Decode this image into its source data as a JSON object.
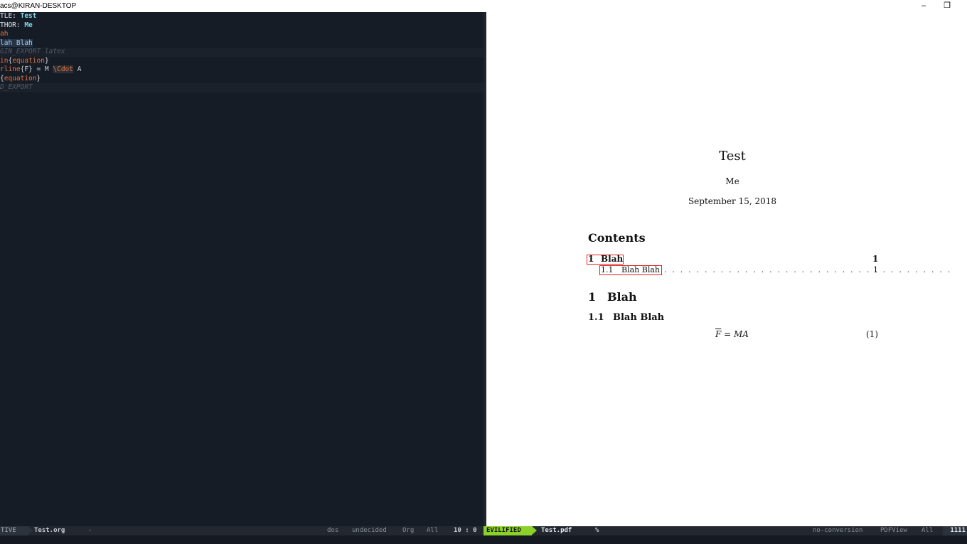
{
  "window": {
    "title": "acs@KIRAN-DESKTOP",
    "minimize_symbol": "–",
    "restore_symbol": "❐"
  },
  "editor": {
    "lines": [
      {
        "kw": "TLE: ",
        "val": "Test"
      },
      {
        "kw": "THOR: ",
        "val": "Me"
      },
      {
        "heading": "ah"
      },
      {
        "heading2": "lah Blah"
      },
      {
        "meta": "GIN_EXPORT latex"
      },
      {
        "a": "in",
        "b": "{",
        "c": "equation",
        "d": "}"
      },
      {
        "a": "rline",
        "b": "{F} = M ",
        "c": "\\Cdot",
        "d": " A"
      },
      {
        "a": "",
        "b": "{",
        "c": "equation",
        "d": "}"
      },
      {
        "meta": "D_EXPORT"
      }
    ]
  },
  "pdf": {
    "title": "Test",
    "author": "Me",
    "date": "September 15, 2018",
    "contents_heading": "Contents",
    "toc": [
      {
        "num": "1",
        "label": "Blah",
        "page": "1"
      },
      {
        "num": "1.1",
        "label": "Blah Blah",
        "dots": ". . . . . . . . . . . . . . . . . . . . . . . . . . . . . . . . . . . .",
        "page": "1"
      }
    ],
    "section1": {
      "num": "1",
      "title": "Blah"
    },
    "section11": {
      "num": "1.1",
      "title": "Blah Blah"
    },
    "equation": {
      "lhs": "F",
      "eq": " = ",
      "rhs": "MA",
      "number": "(1)"
    }
  },
  "modeline_left": {
    "state": "TIVE",
    "buffer": "Test.org",
    "modified": "-",
    "eol": "dos",
    "coding": "undecided",
    "major_mode": "Org",
    "position": "All",
    "line_col": "10 : 0"
  },
  "modeline_right": {
    "state": "EVILIFIED",
    "buffer": "Test.pdf",
    "percent": "%",
    "encoding": "no-conversion",
    "major_mode": "PDFView",
    "position": "All",
    "page": "1111"
  },
  "colors": {
    "editor_bg": "#161c26",
    "evilified_green": "#8bd12a",
    "link_box_red": "#e02020",
    "org_orange": "#e4733f",
    "keyword_cyan": "#7fd9e8"
  }
}
